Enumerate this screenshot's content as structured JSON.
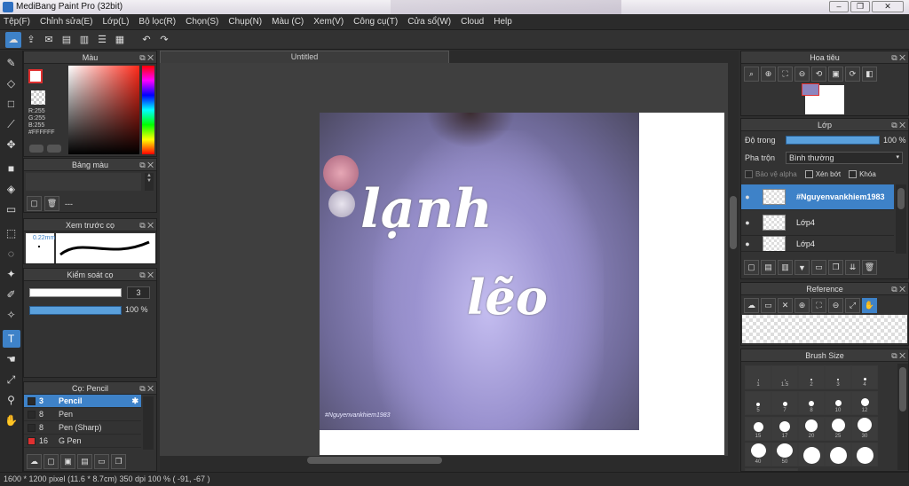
{
  "window": {
    "title": "MediBang Paint Pro (32bit)",
    "buttons": [
      "–",
      "❐",
      "✕"
    ]
  },
  "menu": [
    "Tệp(F)",
    "Chỉnh sửa(E)",
    "Lớp(L)",
    "Bộ lọc(R)",
    "Chọn(S)",
    "Chụp(N)",
    "Màu (C)",
    "Xem(V)",
    "Công cụ(T)",
    "Cửa sổ(W)",
    "Cloud",
    "Help"
  ],
  "color_panel": {
    "title": "Màu",
    "r": "R:255",
    "g": "G:255",
    "b": "B:255",
    "hex": "#FFFFFF",
    "fg": "#ffffff",
    "bg": "#ffffff"
  },
  "palette_panel": {
    "title": "Bảng màu",
    "value": "---"
  },
  "brush_preview": {
    "title": "Xem trước cọ",
    "size": "0.22mm"
  },
  "brush_control": {
    "title": "Kiểm soát cọ",
    "size_value": "3",
    "opacity_value": "100 %",
    "opacity": 1.0
  },
  "brush_list": {
    "title": "Cọ: Pencil",
    "items": [
      {
        "num": "3",
        "name": "Pencil",
        "color": "#2a2a2a"
      },
      {
        "num": "8",
        "name": "Pen",
        "color": "#2a2a2a"
      },
      {
        "num": "8",
        "name": "Pen (Sharp)",
        "color": "#2a2a2a"
      },
      {
        "num": "16",
        "name": "G Pen",
        "color": "#e03030"
      }
    ]
  },
  "document": {
    "tab": "Untitled",
    "text1": "lạnh",
    "text2": "lẽo",
    "watermark": "#Nguyenvankhiem1983"
  },
  "navigator": {
    "title": "Hoa tiêu"
  },
  "layers": {
    "title": "Lớp",
    "opacity_label": "Độ trong",
    "opacity_value": "100 %",
    "opacity": 1.0,
    "blend_label": "Pha trộn",
    "blend_value": "Bình thường",
    "protect_alpha": "Bảo vệ alpha",
    "clipping": "Xén bớt",
    "lock": "Khóa",
    "rows": [
      {
        "name": "#Nguyenvankhiem1983",
        "selected": true
      },
      {
        "name": "Lớp4",
        "selected": false
      },
      {
        "name": "Lớp4",
        "selected": false
      }
    ]
  },
  "reference": {
    "title": "Reference"
  },
  "brush_size": {
    "title": "Brush Size",
    "sizes": [
      "1",
      "1.5",
      "2",
      "3",
      "4",
      "5",
      "7",
      "8",
      "10",
      "12",
      "15",
      "17",
      "20",
      "25",
      "30",
      "40",
      "50",
      "",
      "",
      "",
      "",
      ""
    ]
  },
  "status": {
    "dimensions": "1600 * 1200 pixel",
    "physical": "(11.6 * 8.7cm)",
    "dpi": "350 dpi",
    "zoom": "100 %",
    "coords": "( -91, -67 )"
  }
}
